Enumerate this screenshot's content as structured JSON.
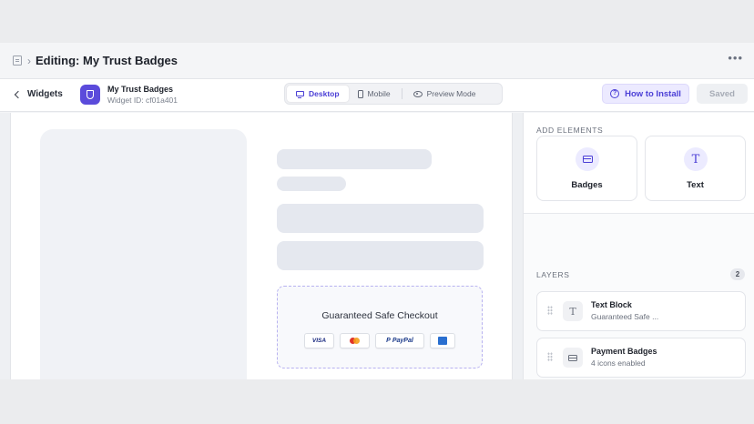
{
  "titlebar": {
    "icon": "document-icon",
    "separator": "›",
    "title": "Editing: My Trust Badges",
    "more": "•••"
  },
  "toolbar": {
    "back_label": "Widgets",
    "widget_name": "My Trust Badges",
    "widget_id": "Widget ID: cf01a401",
    "views": [
      {
        "label": "Desktop",
        "icon": "monitor-icon",
        "active": true
      },
      {
        "label": "Mobile",
        "icon": "phone-icon",
        "active": false
      },
      {
        "label": "Preview Mode",
        "icon": "eye-icon",
        "active": false
      }
    ],
    "install_label": "How to Install",
    "saved_label": "Saved"
  },
  "preview": {
    "trust_title": "Guaranteed Safe Checkout",
    "badges": {
      "visa": "VISA",
      "mastercard": "mastercard-logo",
      "paypal": "PayPal",
      "amex": "amex-logo"
    }
  },
  "panel": {
    "add_label": "ADD ELEMENTS",
    "elements": [
      {
        "label": "Badges",
        "icon": "credit-card-icon"
      },
      {
        "label": "Text",
        "icon": "text-icon"
      }
    ],
    "layers_label": "LAYERS",
    "layers_count": "2",
    "layers": [
      {
        "title": "Text Block",
        "subtitle": "Guaranteed Safe ...",
        "icon": "text-icon"
      },
      {
        "title": "Payment Badges",
        "subtitle": "4 icons enabled",
        "icon": "credit-card-icon"
      }
    ]
  },
  "colors": {
    "accent": "#4b3fd6",
    "accent_light": "#eceaff",
    "placeholder": "#e5e8ef"
  }
}
